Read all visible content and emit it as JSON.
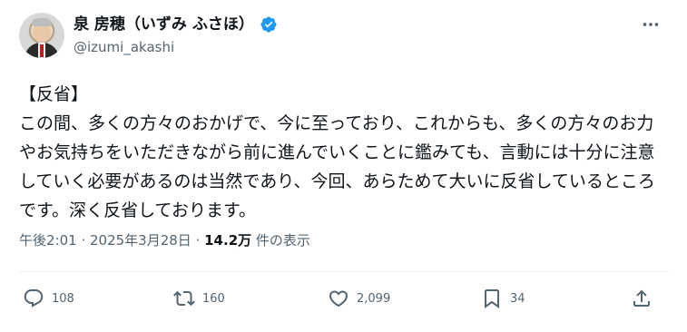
{
  "author": {
    "display_name": "泉 房穂（いずみ ふさほ）",
    "handle": "@izumi_akashi",
    "avatar_icon": "profile-photo",
    "verified_icon": "verified-badge-icon",
    "verified_color": "#1d9bf0"
  },
  "post": {
    "text": "【反省】\nこの間、多くの方々のおかげで、今に至っており、これからも、多くの方々のお力やお気持ちをいただきながら前に進んでいくことに鑑みても、言動には十分に注意していく必要があるのは当然であり、今回、あらためて大いに反省しているところです。深く反省しております。"
  },
  "meta": {
    "time": "午後2:01",
    "separator1": " · ",
    "date": "2025年3月28日",
    "separator2": " · ",
    "views": "14.2万",
    "views_label": " 件の表示"
  },
  "actions": {
    "replies": "108",
    "retweets": "160",
    "likes": "2,099",
    "bookmarks": "34"
  },
  "colors": {
    "text": "#0f1419",
    "muted": "#536471",
    "accent": "#1d9bf0"
  }
}
